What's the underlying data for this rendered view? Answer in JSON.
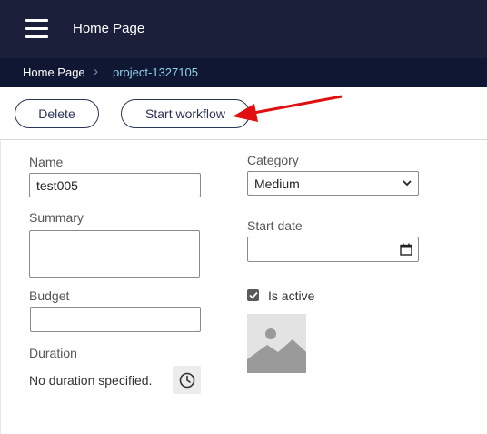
{
  "header": {
    "title": "Home Page",
    "menu_icon": "hamburger-menu-icon"
  },
  "breadcrumb": {
    "home": "Home Page",
    "separator": "›",
    "current": "project-1327105"
  },
  "toolbar": {
    "delete_label": "Delete",
    "start_workflow_label": "Start workflow"
  },
  "form": {
    "name": {
      "label": "Name",
      "value": "test005"
    },
    "summary": {
      "label": "Summary",
      "value": ""
    },
    "budget": {
      "label": "Budget",
      "value": ""
    },
    "duration": {
      "label": "Duration",
      "value": "No duration specified.",
      "icon": "clock-icon"
    },
    "category": {
      "label": "Category",
      "value": "Medium",
      "icon": "chevron-down-icon"
    },
    "start_date": {
      "label": "Start date",
      "value": "",
      "icon": "calendar-icon"
    },
    "is_active": {
      "label": "Is active",
      "checked": true
    },
    "image": {
      "icon": "image-placeholder-icon"
    }
  },
  "annotation": {
    "arrow_color": "#e01010",
    "icon": "red-arrow-annotation"
  },
  "colors": {
    "header_bg": "#1b1f3a",
    "breadcrumb_bg": "#101733",
    "breadcrumb_current": "#8fd0e8",
    "button_border": "#2b3556"
  }
}
